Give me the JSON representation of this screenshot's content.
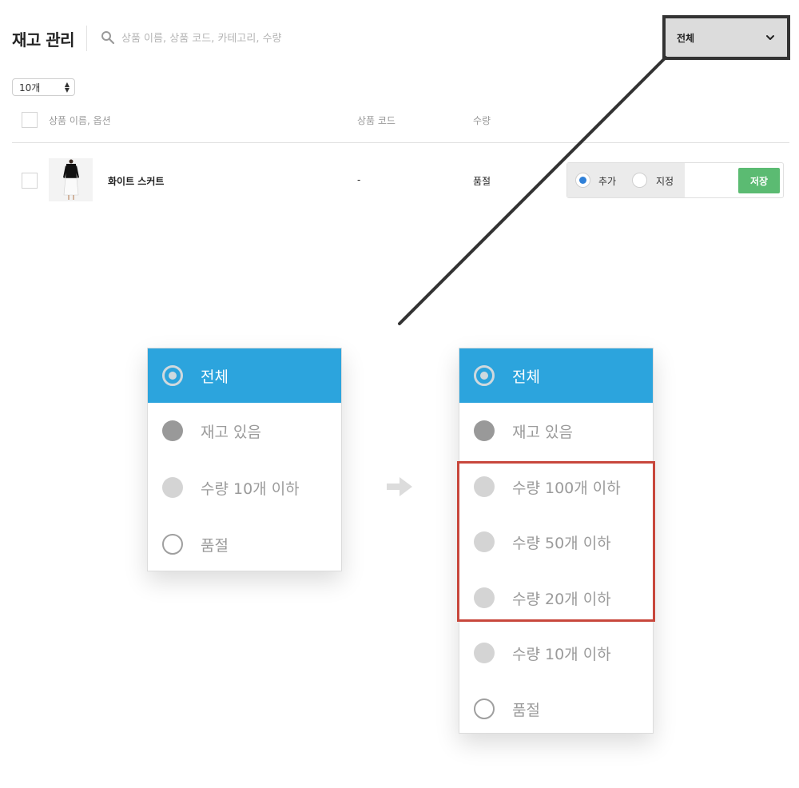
{
  "header": {
    "title": "재고 관리",
    "search_placeholder": "상품 이름, 상품 코드, 카테고리, 수량",
    "filter_value": "전체"
  },
  "toolbar": {
    "page_size": "10개"
  },
  "table": {
    "columns": [
      "상품 이름, 옵션",
      "상품 코드",
      "수량"
    ],
    "rows": [
      {
        "name": "화이트 스커트",
        "code": "-",
        "quantity": "품절",
        "mode_options": [
          "추가",
          "지정"
        ],
        "mode_selected": "추가",
        "save_label": "저장"
      }
    ]
  },
  "dropdown_before": {
    "options": [
      "전체",
      "재고 있음",
      "수량 10개 이하",
      "품절"
    ],
    "selected": "전체"
  },
  "dropdown_after": {
    "options": [
      "전체",
      "재고 있음",
      "수량 100개 이하",
      "수량 50개 이하",
      "수량 20개 이하",
      "수량 10개 이하",
      "품절"
    ],
    "selected": "전체",
    "highlighted": [
      "수량 100개 이하",
      "수량 50개 이하",
      "수량 20개 이하"
    ]
  },
  "colors": {
    "selected_option_bg": "#2ca4dd",
    "save_button": "#5bbb72",
    "highlight_border": "#c8473c",
    "radio_on": "#2f80d8"
  },
  "icons": [
    "search-icon",
    "chevron-down-icon",
    "sort-updown-icon",
    "arrow-right-icon"
  ]
}
